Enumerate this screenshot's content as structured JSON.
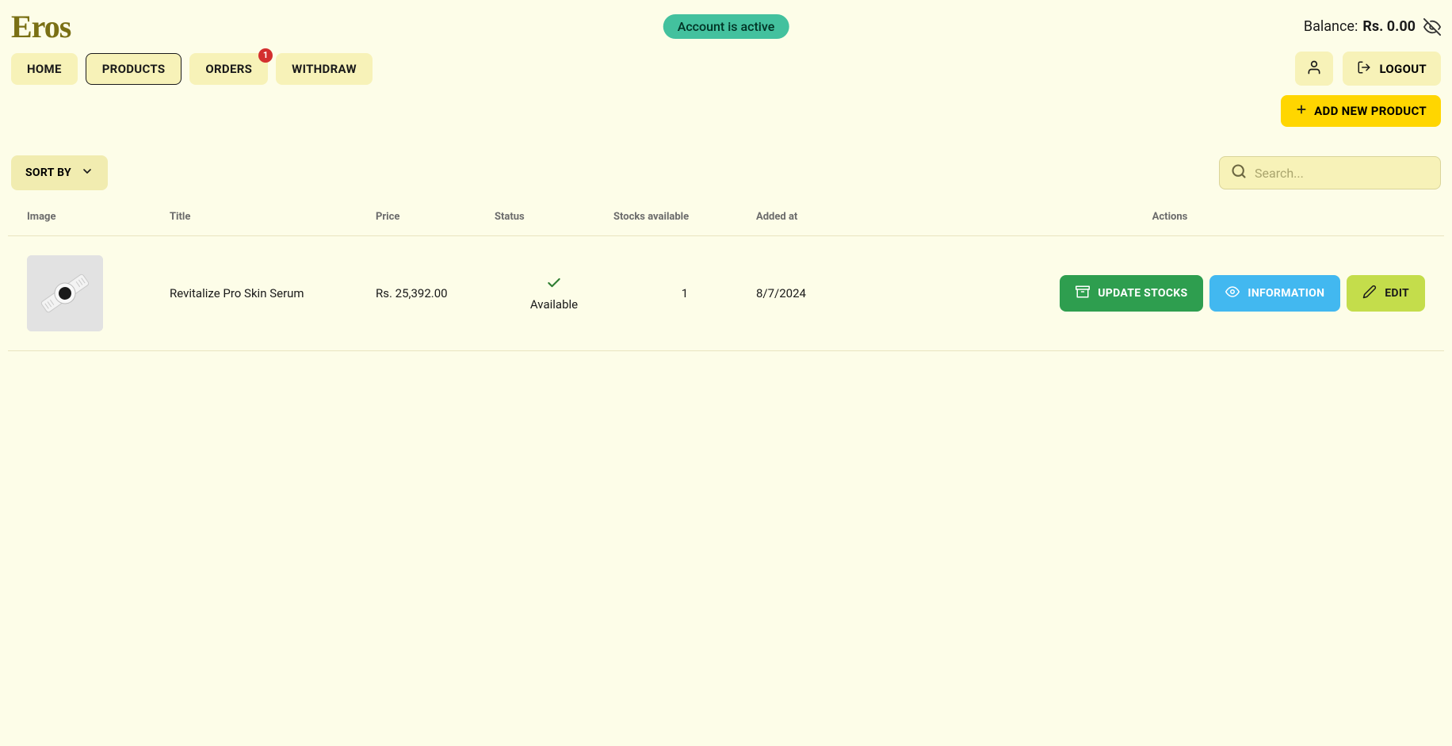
{
  "brand": "Eros",
  "account_status": "Account is active",
  "balance": {
    "label": "Balance:",
    "value": "Rs. 0.00"
  },
  "nav": {
    "home": "HOME",
    "products": "PRODUCTS",
    "orders": "ORDERS",
    "orders_badge": "1",
    "withdraw": "WITHDRAW"
  },
  "actions": {
    "logout": "LOGOUT",
    "add_product": "ADD NEW PRODUCT"
  },
  "sort": {
    "label": "SORT BY"
  },
  "search": {
    "placeholder": "Search..."
  },
  "table": {
    "headers": {
      "image": "Image",
      "title": "Title",
      "price": "Price",
      "status": "Status",
      "stocks": "Stocks available",
      "added": "Added at",
      "actions": "Actions"
    },
    "rows": [
      {
        "title": "Revitalize Pro Skin Serum",
        "price": "Rs. 25,392.00",
        "status": "Available",
        "stocks": "1",
        "added_at": "8/7/2024"
      }
    ],
    "row_actions": {
      "update_stocks": "UPDATE STOCKS",
      "information": "INFORMATION",
      "edit": "EDIT"
    }
  }
}
